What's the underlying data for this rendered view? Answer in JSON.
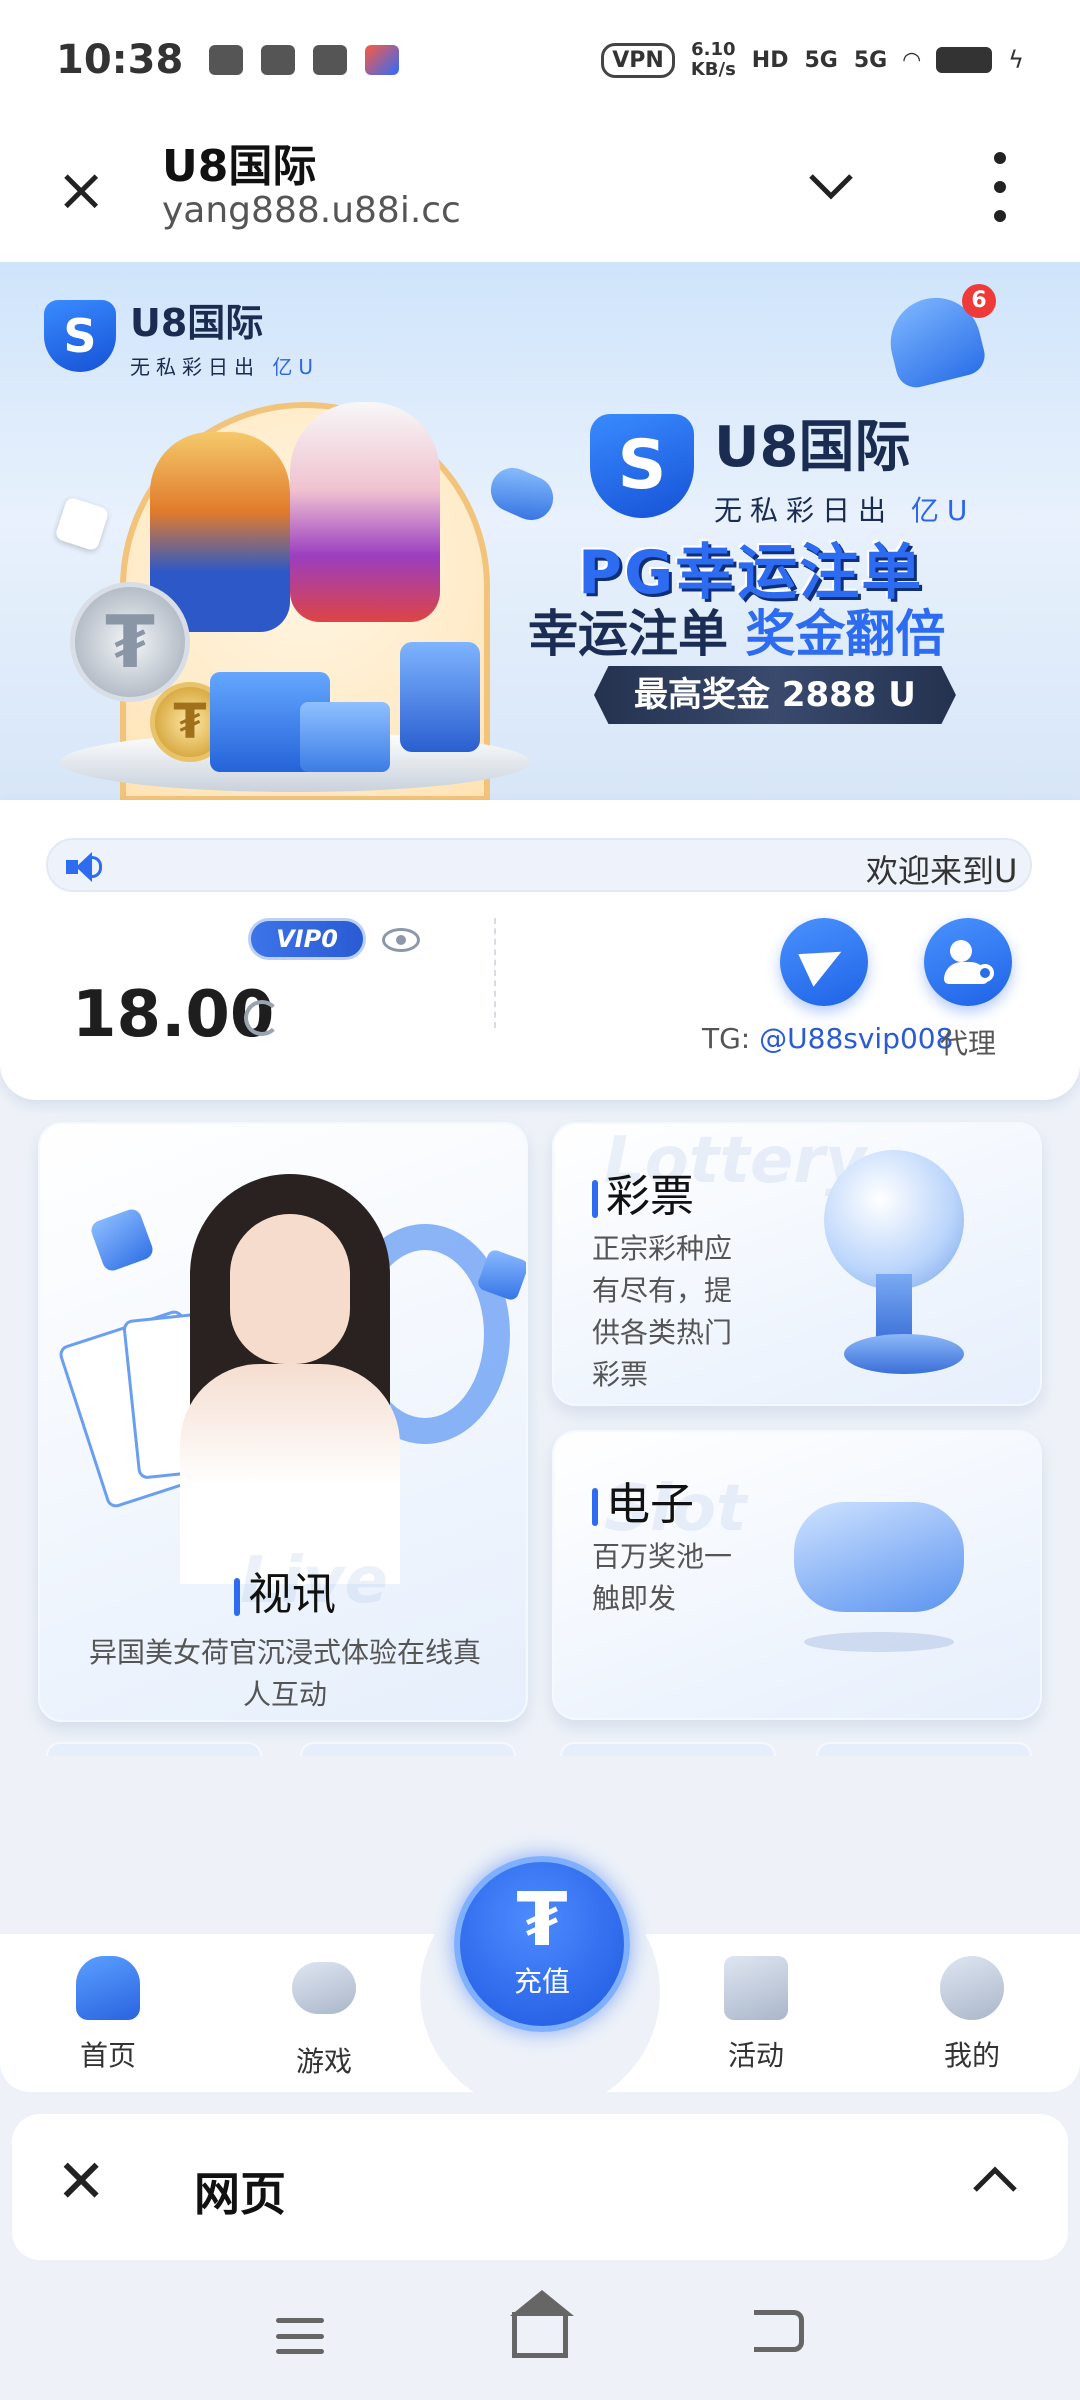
{
  "status_bar": {
    "time": "10:38",
    "vpn": "VPN",
    "net_speed_value": "6.10",
    "net_speed_unit": "KB/s",
    "hd": "HD",
    "sim1": "5G",
    "sim2": "5G"
  },
  "browser": {
    "title": "U8国际",
    "url": "yang888.u88i.cc",
    "chevron": "⌄"
  },
  "banner": {
    "brand": "U8国际",
    "slogan_main": "无私彩日出",
    "slogan_highlight": "亿U",
    "notification_count": "6",
    "promo_line1": "PG幸运注单",
    "promo_line2_main": "幸运注单",
    "promo_line2_highlight": "奖金翻倍",
    "promo_line3": "最高奖金 2888 U"
  },
  "account": {
    "marquee": "欢迎来到U",
    "vip_level": "VIP0",
    "balance": "18.00",
    "tg_prefix": "TG: ",
    "tg_handle": "@U88svip008",
    "agent_label": "代理"
  },
  "games": {
    "live": {
      "watermark": "Live",
      "title": "视讯",
      "desc": "异国美女荷官沉浸式体验在线真人互动"
    },
    "lottery": {
      "watermark": "Lottery",
      "title": "彩票",
      "desc": "正宗彩种应有尽有，提供各类热门彩票"
    },
    "slot": {
      "watermark": "Slot",
      "title": "电子",
      "desc": "百万奖池一触即发"
    }
  },
  "tabbar": {
    "home": "首页",
    "games": "游戏",
    "deposit": "充值",
    "deposit_symbol": "₮",
    "events": "活动",
    "me": "我的"
  },
  "bottom_bar": {
    "label": "网页",
    "close": "✕",
    "expand": "︿"
  }
}
